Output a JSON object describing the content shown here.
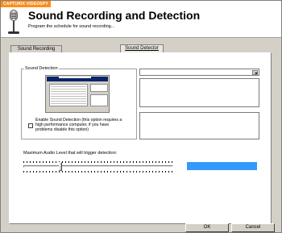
{
  "header": {
    "brand": "CAPTURIX VIDEOSPY",
    "title": "Sound Recording and Detection",
    "subtitle": "Program the schedule for sound recording..."
  },
  "tabs": [
    {
      "label": "Sound Recording",
      "selected": false
    },
    {
      "label": "Sound Detector",
      "selected": true
    }
  ],
  "detector": {
    "group_label": "Sound Detection",
    "checkbox_label": "Enable Sound Detection (this option requires a high performance computer, if you have problems disable this option)",
    "checkbox_checked": false,
    "dropdown_value": "",
    "level_label": "Maximum Audio Level that will trigger detection:",
    "slider_fraction": 0.24
  },
  "buttons": {
    "ok": "OK",
    "cancel": "Cancel"
  },
  "colors": {
    "brand": "#ff8c1a",
    "level_meter": "#3399ff"
  }
}
